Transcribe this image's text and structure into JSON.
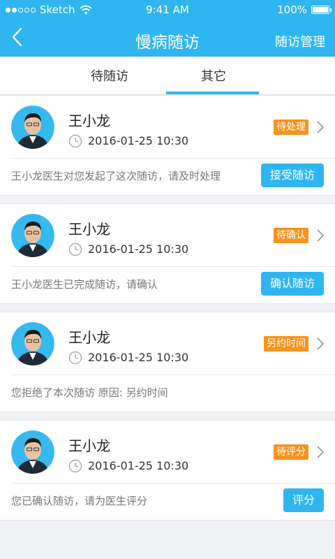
{
  "status_bar": {
    "carrier": "Sketch",
    "time": "9:41 AM",
    "battery": "100%",
    "battery_level": 1.0
  },
  "nav": {
    "title": "慢病随访",
    "right_action": "随访管理",
    "back_icon": "chevron-left-icon"
  },
  "tabs": [
    {
      "label": "待随访",
      "active": false
    },
    {
      "label": "其它",
      "active": true
    }
  ],
  "colors": {
    "primary": "#2fb6f0",
    "badge": "#f6921e",
    "background": "#f0f1f4"
  },
  "cards": [
    {
      "name": "王小龙",
      "datetime": "2016-01-25 10:30",
      "status": "待处理",
      "message": "王小龙医生对您发起了这次随访，请及时处理",
      "action": "接受随访"
    },
    {
      "name": "王小龙",
      "datetime": "2016-01-25 10:30",
      "status": "待确认",
      "message": "王小龙医生已完成随访，请确认",
      "action": "确认随访"
    },
    {
      "name": "王小龙",
      "datetime": "2016-01-25 10:30",
      "status": "另约时间",
      "message": "您拒绝了本次随访   原因: 另约时间",
      "action": null
    },
    {
      "name": "王小龙",
      "datetime": "2016-01-25 10:30",
      "status": "待评分",
      "message": "您已确认随访，请为医生评分",
      "action": "评分"
    }
  ]
}
